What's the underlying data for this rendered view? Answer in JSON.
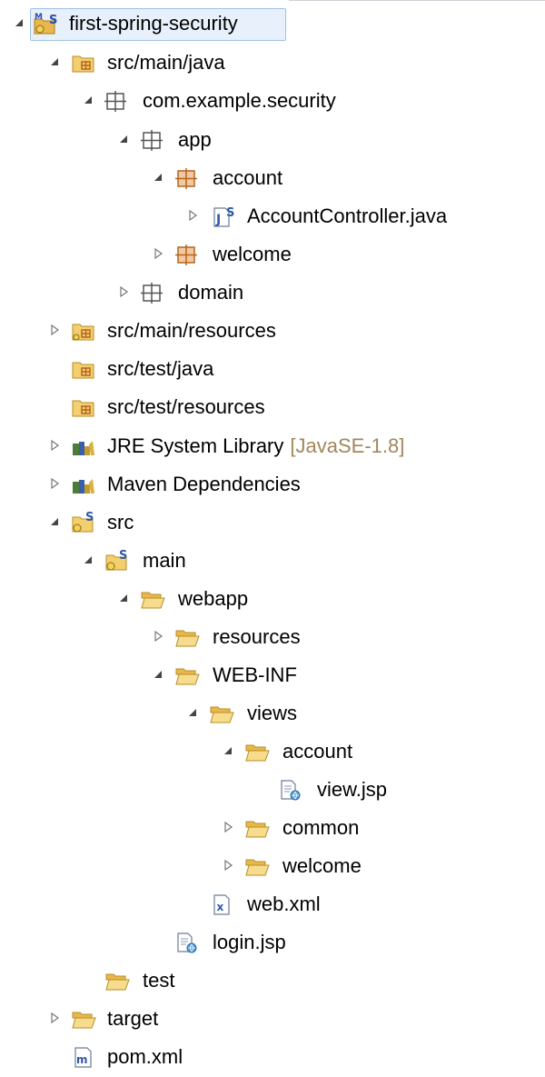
{
  "tree": {
    "project": {
      "label": "first-spring-security",
      "icon": "maven-spring-project-icon"
    },
    "src_main_java": {
      "label": "src/main/java",
      "icon": "source-folder-icon"
    },
    "pkg_root": {
      "label": "com.example.security",
      "icon": "package-icon"
    },
    "pkg_app": {
      "label": "app",
      "icon": "package-icon"
    },
    "pkg_account": {
      "label": "account",
      "icon": "package-filled-icon"
    },
    "account_controller": {
      "label": "AccountController.java",
      "icon": "java-spring-file-icon"
    },
    "pkg_welcome": {
      "label": "welcome",
      "icon": "package-filled-icon"
    },
    "pkg_domain": {
      "label": "domain",
      "icon": "package-icon"
    },
    "src_main_resources": {
      "label": "src/main/resources",
      "icon": "source-folder-icon"
    },
    "src_test_java": {
      "label": "src/test/java",
      "icon": "source-folder-icon"
    },
    "src_test_resources": {
      "label": "src/test/resources",
      "icon": "source-folder-icon"
    },
    "jre_library": {
      "label": "JRE System Library",
      "suffix": "[JavaSE-1.8]",
      "icon": "library-icon"
    },
    "maven_deps": {
      "label": "Maven Dependencies",
      "icon": "library-icon"
    },
    "src": {
      "label": "src",
      "icon": "spring-folder-icon"
    },
    "main": {
      "label": "main",
      "icon": "spring-folder-icon"
    },
    "webapp": {
      "label": "webapp",
      "icon": "folder-icon"
    },
    "resources": {
      "label": "resources",
      "icon": "folder-icon"
    },
    "web_inf": {
      "label": "WEB-INF",
      "icon": "folder-icon"
    },
    "views": {
      "label": "views",
      "icon": "folder-icon"
    },
    "views_account": {
      "label": "account",
      "icon": "folder-icon"
    },
    "view_jsp": {
      "label": "view.jsp",
      "icon": "jsp-file-icon"
    },
    "common": {
      "label": "common",
      "icon": "folder-icon"
    },
    "views_welcome": {
      "label": "welcome",
      "icon": "folder-icon"
    },
    "web_xml": {
      "label": "web.xml",
      "icon": "xml-file-icon"
    },
    "login_jsp": {
      "label": "login.jsp",
      "icon": "jsp-file-icon"
    },
    "test": {
      "label": "test",
      "icon": "folder-icon"
    },
    "target": {
      "label": "target",
      "icon": "folder-icon"
    },
    "pom_xml": {
      "label": "pom.xml",
      "icon": "maven-pom-file-icon"
    }
  },
  "colors": {
    "selection_bg": "#e7f0fb",
    "selection_border": "#9fc1e6",
    "folder": "#f0c96e",
    "package": "#b5651d",
    "decorator_suffix": "#a0875a"
  }
}
